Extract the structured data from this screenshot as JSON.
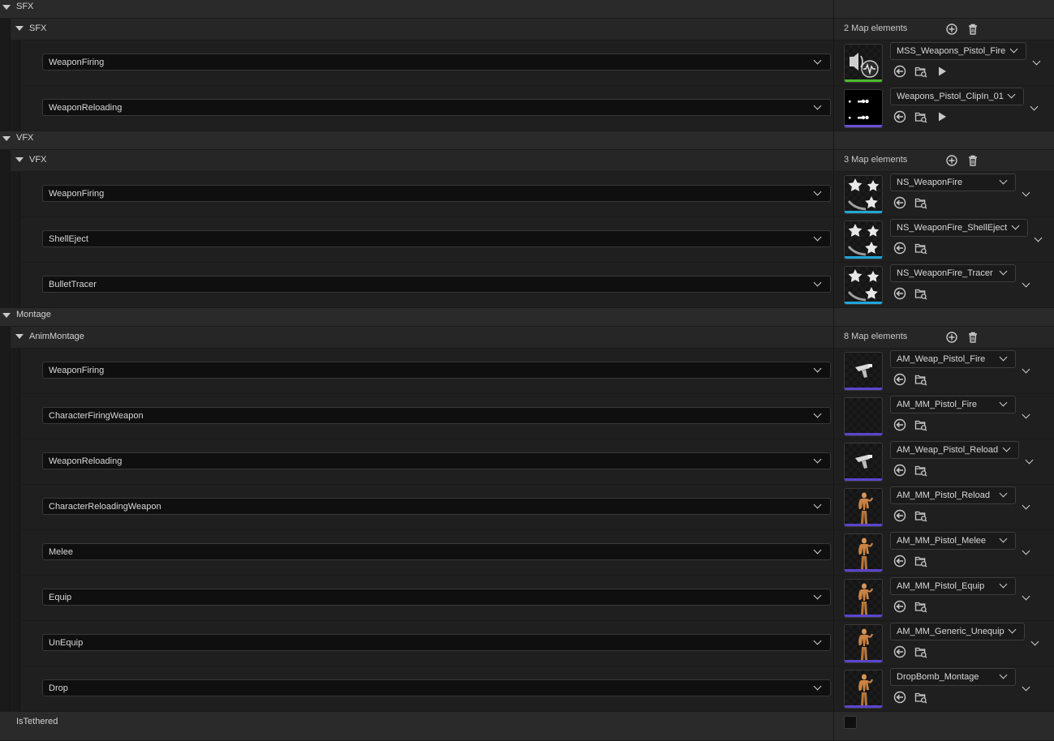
{
  "categories": [
    {
      "title": "SFX",
      "map": {
        "title": "SFX",
        "count_label": "2 Map elements",
        "entries": [
          {
            "key": "WeaponFiring",
            "asset": "MSS_Weapons_Pistol_Fire",
            "thumb": "sound-wave-icon",
            "bar_color": "#4cbb2f",
            "has_play": true
          },
          {
            "key": "WeaponReloading",
            "asset": "Weapons_Pistol_ClipIn_01",
            "thumb": "sound-dots-icon",
            "bar_color": "#6a4fd8",
            "has_play": true
          }
        ]
      }
    },
    {
      "title": "VFX",
      "map": {
        "title": "VFX",
        "count_label": "3 Map elements",
        "entries": [
          {
            "key": "WeaponFiring",
            "asset": "NS_WeaponFire",
            "thumb": "niagara-stars-icon",
            "bar_color": "#22a6d8",
            "has_play": false
          },
          {
            "key": "ShellEject",
            "asset": "NS_WeaponFire_ShellEject",
            "thumb": "niagara-stars-icon",
            "bar_color": "#22a6d8",
            "has_play": false
          },
          {
            "key": "BulletTracer",
            "asset": "NS_WeaponFire_Tracer",
            "thumb": "niagara-stars-icon",
            "bar_color": "#22a6d8",
            "has_play": false
          }
        ]
      }
    },
    {
      "title": "Montage",
      "map": {
        "title": "AnimMontage",
        "count_label": "8 Map elements",
        "entries": [
          {
            "key": "WeaponFiring",
            "asset": "AM_Weap_Pistol_Fire",
            "thumb": "pistol-icon",
            "bar_color": "#5a45d0",
            "has_play": false
          },
          {
            "key": "CharacterFiringWeapon",
            "asset": "AM_MM_Pistol_Fire",
            "thumb": "empty-thumbnail",
            "bar_color": "#5a45d0",
            "has_play": false
          },
          {
            "key": "WeaponReloading",
            "asset": "AM_Weap_Pistol_Reload",
            "thumb": "pistol-icon",
            "bar_color": "#5a45d0",
            "has_play": false
          },
          {
            "key": "CharacterReloadingWeapon",
            "asset": "AM_MM_Pistol_Reload",
            "thumb": "mannequin-icon",
            "bar_color": "#5a45d0",
            "has_play": false
          },
          {
            "key": "Melee",
            "asset": "AM_MM_Pistol_Melee",
            "thumb": "mannequin-icon",
            "bar_color": "#5a45d0",
            "has_play": false
          },
          {
            "key": "Equip",
            "asset": "AM_MM_Pistol_Equip",
            "thumb": "mannequin-icon",
            "bar_color": "#5a45d0",
            "has_play": false
          },
          {
            "key": "UnEquip",
            "asset": "AM_MM_Generic_Unequip",
            "thumb": "mannequin-icon",
            "bar_color": "#5a45d0",
            "has_play": false
          },
          {
            "key": "Drop",
            "asset": "DropBomb_Montage",
            "thumb": "mannequin-icon",
            "bar_color": "#5a45d0",
            "has_play": false
          }
        ]
      }
    }
  ],
  "footer": {
    "label": "IsTethered",
    "checked": false
  },
  "icons": {
    "add": "add-element-icon",
    "delete": "delete-icon",
    "use_selected": "use-selected-icon",
    "browse": "browse-asset-icon",
    "play": "play-icon",
    "expand": "chevron-down-icon"
  }
}
